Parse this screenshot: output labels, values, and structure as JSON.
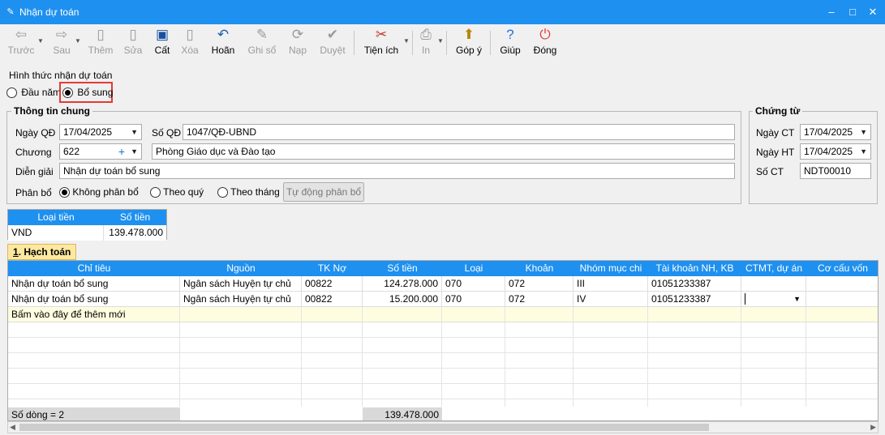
{
  "window": {
    "title": "Nhận dự toán"
  },
  "toolbar": {
    "prev": "Trước",
    "next": "Sau",
    "add": "Thêm",
    "edit": "Sửa",
    "save": "Cất",
    "delete": "Xóa",
    "undo": "Hoãn",
    "post": "Ghi sổ",
    "load": "Nạp",
    "approve": "Duyệt",
    "utilities": "Tiện ích",
    "print": "In",
    "feedback": "Góp ý",
    "help": "Giúp",
    "close": "Đóng"
  },
  "receive_type": {
    "label": "Hình thức nhận dự toán",
    "option1": "Đầu năm",
    "option2": "Bổ sung",
    "selected": "Bổ sung"
  },
  "general": {
    "title": "Thông tin chung",
    "decision_date_label": "Ngày QĐ",
    "decision_date": "17/04/2025",
    "decision_no_label": "Số QĐ",
    "decision_no": "1047/QĐ-UBND",
    "chapter_label": "Chương",
    "chapter": "622",
    "chapter_name": "Phòng Giáo dục và Đào tạo",
    "description_label": "Diễn giải",
    "description": "Nhận dự toán bổ sung",
    "allocation_label": "Phân bổ",
    "alloc_none": "Không phân bổ",
    "alloc_quarter": "Theo quý",
    "alloc_month": "Theo tháng",
    "auto_alloc_button": "Tự động phân bổ"
  },
  "voucher": {
    "title": "Chứng từ",
    "date_label": "Ngày CT",
    "date": "17/04/2025",
    "post_date_label": "Ngày HT",
    "post_date": "17/04/2025",
    "number_label": "Số CT",
    "number": "NDT00010"
  },
  "currency_table": {
    "headers": [
      "Loại tiền",
      "Số tiền"
    ],
    "currency": "VND",
    "amount": "139.478.000"
  },
  "tab": {
    "number": "1",
    "label": ". Hạch toán"
  },
  "grid": {
    "headers": [
      "Chỉ tiêu",
      "Nguồn",
      "TK Nợ",
      "Số tiền",
      "Loại",
      "Khoản",
      "Nhóm mục chi",
      "Tài khoản NH, KB",
      "CTMT, dự án",
      "Cơ cấu vốn"
    ],
    "rows": [
      {
        "chi_tieu": "Nhận dự toán bổ sung",
        "nguon": "Ngân sách Huyện tự chủ",
        "tk_no": "00822",
        "so_tien": "124.278.000",
        "loai": "070",
        "khoan": "072",
        "nhom": "III",
        "tk_nh": "01051233387"
      },
      {
        "chi_tieu": "Nhận dự toán bổ sung",
        "nguon": "Ngân sách Huyện tự chủ",
        "tk_no": "00822",
        "so_tien": "15.200.000",
        "loai": "070",
        "khoan": "072",
        "nhom": "IV",
        "tk_nh": "01051233387"
      }
    ],
    "new_row_hint": "Bấm vào đây để thêm mới",
    "footer_count": "Số dòng = 2",
    "footer_total": "139.478.000"
  }
}
